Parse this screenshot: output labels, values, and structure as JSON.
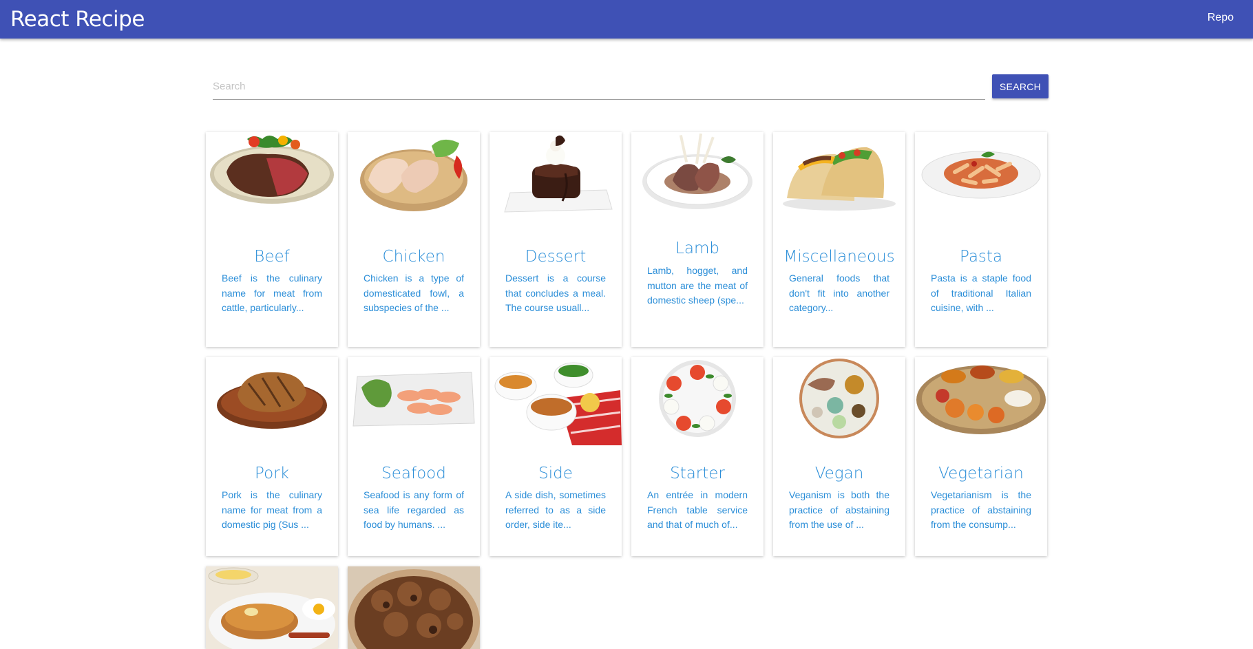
{
  "header": {
    "title": "React Recipe",
    "repo_link": "Repo"
  },
  "search": {
    "placeholder": "Search",
    "value": "",
    "button_label": "SEARCH"
  },
  "categories": [
    {
      "name": "Beef",
      "description": "Beef is the culinary name for meat from cattle, particularly...",
      "icon": "beef-steak-image"
    },
    {
      "name": "Chicken",
      "description": "Chicken is a type of domesticated fowl, a subspecies of the ...",
      "icon": "chicken-legs-image"
    },
    {
      "name": "Dessert",
      "description": "Dessert is a course that concludes a meal. The course usuall...",
      "icon": "chocolate-dessert-image"
    },
    {
      "name": "Lamb",
      "description": "Lamb, hogget, and mutton are the meat of domestic sheep (spe...",
      "icon": "lamb-chops-image"
    },
    {
      "name": "Miscellaneous",
      "description": "General foods that don't fit into another category...",
      "icon": "tacos-image"
    },
    {
      "name": "Pasta",
      "description": "Pasta is a staple food of traditional Italian cuisine, with ...",
      "icon": "penne-pasta-image"
    },
    {
      "name": "Pork",
      "description": "Pork is the culinary name for meat from a domestic pig (Sus ...",
      "icon": "pork-steak-image"
    },
    {
      "name": "Seafood",
      "description": "Seafood is any form of sea life regarded as food by humans. ...",
      "icon": "salmon-platter-image"
    },
    {
      "name": "Side",
      "description": "A side dish, sometimes referred to as a side order, side ite...",
      "icon": "side-dishes-image"
    },
    {
      "name": "Starter",
      "description": "An entrée in modern French table service and that of much of...",
      "icon": "caprese-salad-image"
    },
    {
      "name": "Vegan",
      "description": "Veganism is both the practice of abstaining from the use of ...",
      "icon": "vegan-bowl-image"
    },
    {
      "name": "Vegetarian",
      "description": "Vegetarianism is the practice of abstaining from the consump...",
      "icon": "indian-thali-image"
    },
    {
      "name": "",
      "description": "",
      "icon": "breakfast-pancakes-image"
    },
    {
      "name": "",
      "description": "",
      "icon": "goat-stew-image"
    }
  ]
}
